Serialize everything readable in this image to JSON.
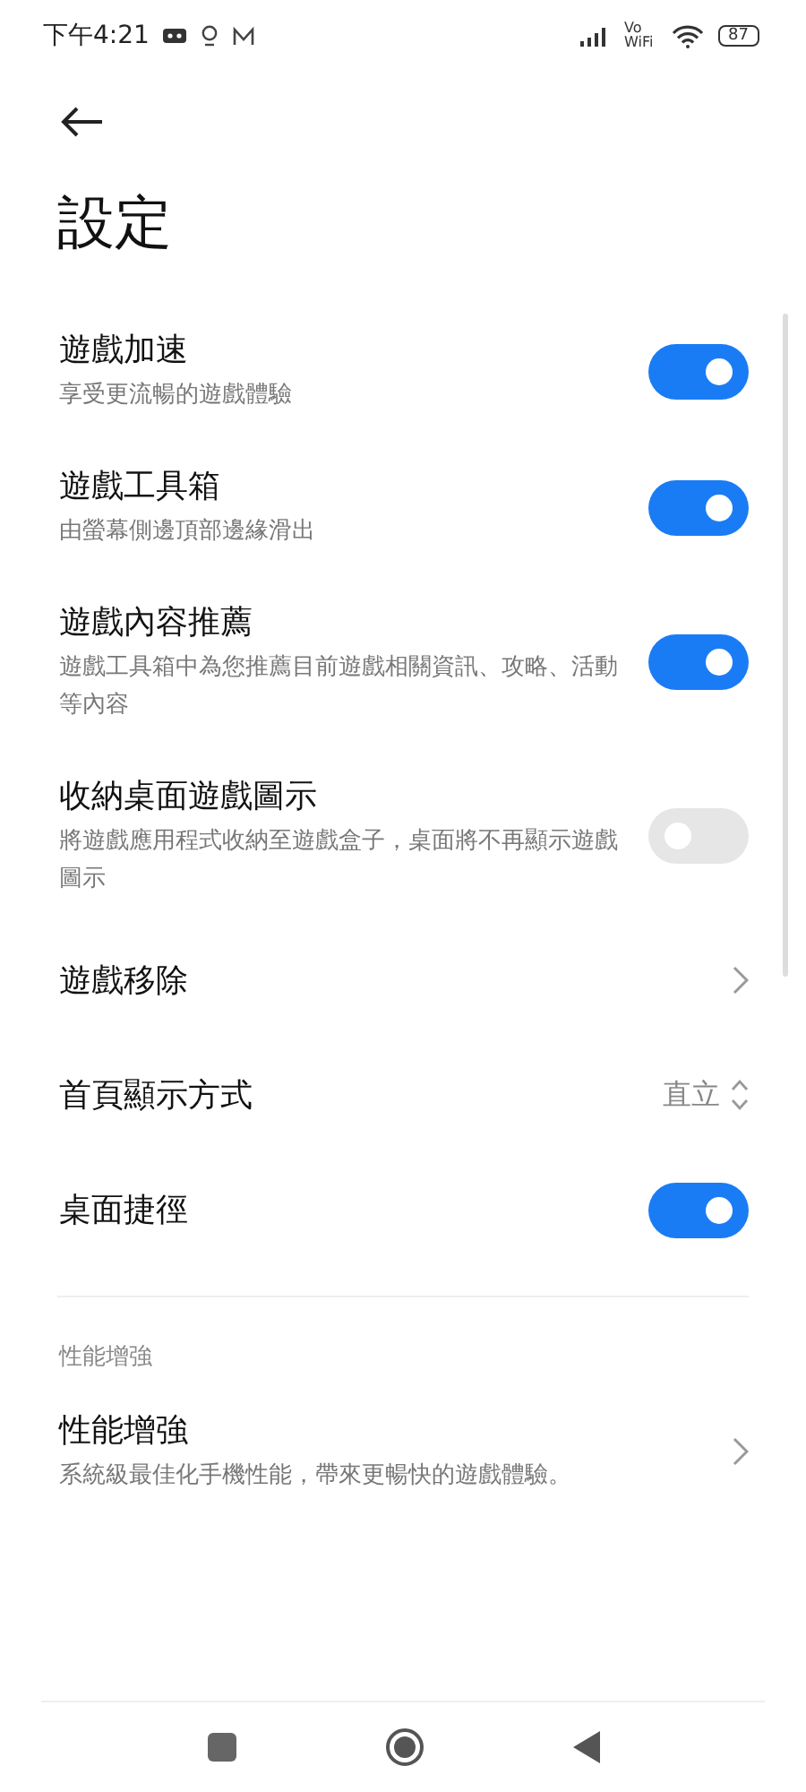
{
  "status_bar": {
    "time": "下午4:21",
    "network_label": "Vo WiFi",
    "battery": "87"
  },
  "title": "設定",
  "items": [
    {
      "kind": "toggle",
      "label": "遊戲加速",
      "description": "享受更流暢的遊戲體驗",
      "on": true
    },
    {
      "kind": "toggle",
      "label": "遊戲工具箱",
      "description": "由螢幕側邊頂部邊緣滑出",
      "on": true
    },
    {
      "kind": "toggle",
      "label": "遊戲內容推薦",
      "description": "遊戲工具箱中為您推薦目前遊戲相關資訊、攻略、活動等內容",
      "on": true
    },
    {
      "kind": "toggle",
      "label": "收納桌面遊戲圖示",
      "description": "將遊戲應用程式收納至遊戲盒子，桌面將不再顯示遊戲圖示",
      "on": false
    },
    {
      "kind": "link",
      "label": "遊戲移除"
    },
    {
      "kind": "select",
      "label": "首頁顯示方式",
      "value": "直立"
    },
    {
      "kind": "toggle",
      "label": "桌面捷徑",
      "on": true
    }
  ],
  "section": {
    "header": "性能增強",
    "items": [
      {
        "kind": "link",
        "label": "性能增強",
        "description": "系統級最佳化手機性能，帶來更暢快的遊戲體驗。"
      }
    ]
  }
}
